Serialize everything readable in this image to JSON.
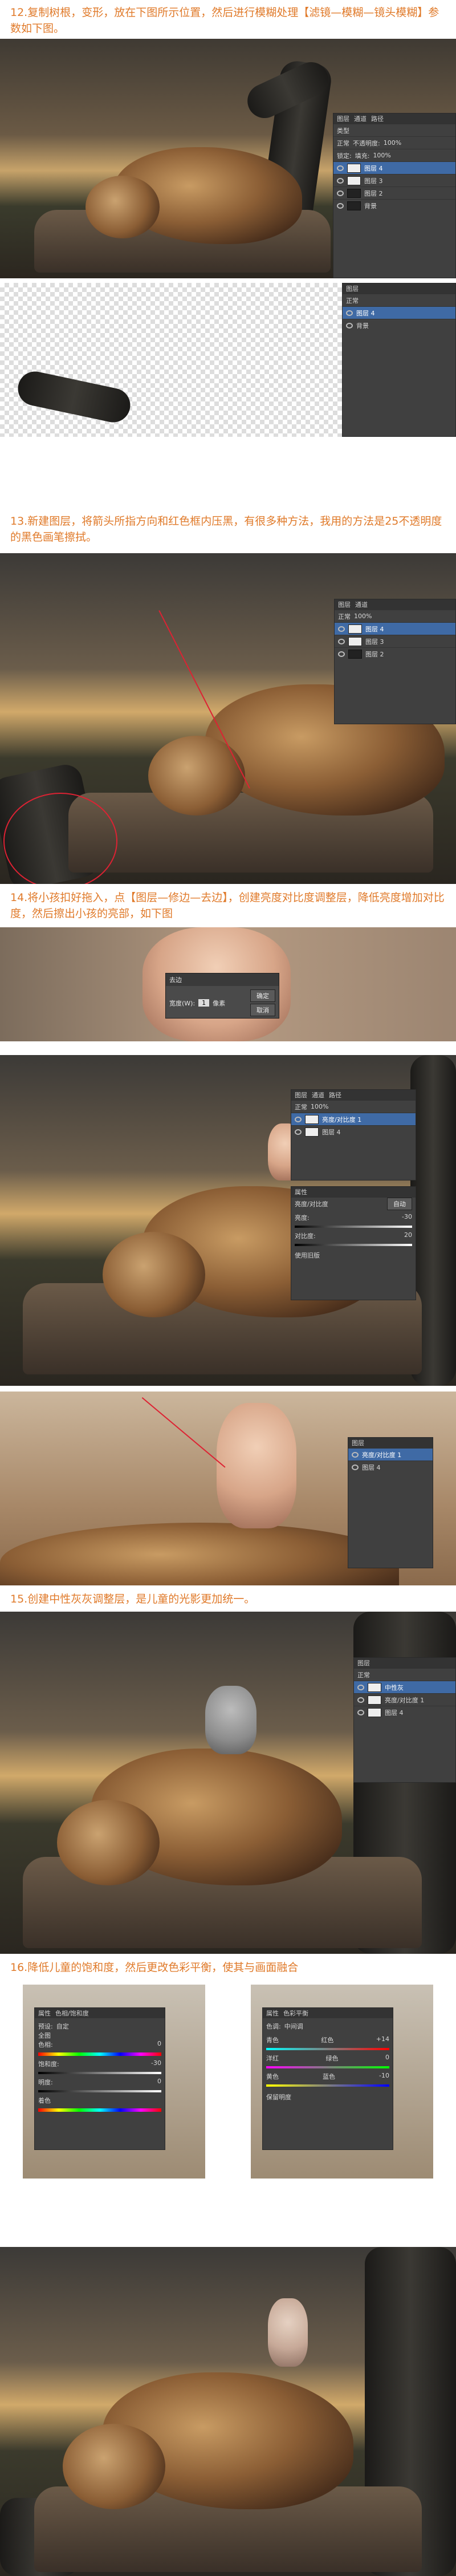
{
  "steps": {
    "s12": "12.复制树根，变形，放在下图所示位置，然后进行模糊处理【滤镜—模糊—镜头模糊】参数如下图。",
    "s13": "13.新建图层，将箭头所指方向和红色框内压黑，有很多种方法，我用的方法是25不透明度的黑色画笔擦拭。",
    "s14": "14.将小孩扣好拖入，点【图层—修边—去边】，创建亮度对比度调整层，降低亮度增加对比度，然后擦出小孩的亮部，如下图",
    "s15": "15.创建中性灰灰调整层，是儿童的光影更加统一。",
    "s16": "16.降低儿童的饱和度，然后更改色彩平衡，使其与画面融合"
  },
  "layers_panel": {
    "tabs": [
      "图层",
      "通道",
      "路径"
    ],
    "blend_mode": "正常",
    "opacity_label": "不透明度:",
    "opacity_value": "100%",
    "fill_label": "填充:",
    "fill_value": "100%",
    "lock_label": "锁定:",
    "layer_names": [
      "图层 4",
      "图层 3",
      "图层 2",
      "背景"
    ],
    "layer_name_fx": "亮度/对比度 1",
    "layer_name_gray": "中性灰",
    "kind_label": "类型"
  },
  "defringe_dialog": {
    "title": "去边",
    "width_label": "宽度(W):",
    "width_value": "1",
    "unit": "像素",
    "ok": "确定",
    "cancel": "取消"
  },
  "properties_panel": {
    "title": "属性",
    "subtitle": "亮度/对比度",
    "auto": "自动",
    "brightness_label": "亮度:",
    "brightness_value": "-30",
    "contrast_label": "对比度:",
    "contrast_value": "20",
    "legacy": "使用旧版"
  },
  "hue_sat_panel": {
    "title": "属性",
    "subtitle": "色相/饱和度",
    "preset_label": "预设:",
    "preset_value": "自定",
    "channel": "全图",
    "hue_label": "色相:",
    "hue_value": "0",
    "sat_label": "饱和度:",
    "sat_value": "-30",
    "light_label": "明度:",
    "light_value": "0",
    "colorize": "着色"
  },
  "color_balance_panel": {
    "title": "属性",
    "subtitle": "色彩平衡",
    "tone_label": "色调:",
    "tone_value": "中间调",
    "rows": [
      {
        "left": "青色",
        "right": "红色",
        "value": "+14"
      },
      {
        "left": "洋红",
        "right": "绿色",
        "value": "0"
      },
      {
        "left": "黄色",
        "right": "蓝色",
        "value": "-10"
      }
    ],
    "preserve": "保留明度"
  },
  "colors": {
    "step_text": "#e07a2a",
    "ps_panel": "#404040",
    "selection": "#3f6aa5",
    "annotation": "#d22233"
  }
}
